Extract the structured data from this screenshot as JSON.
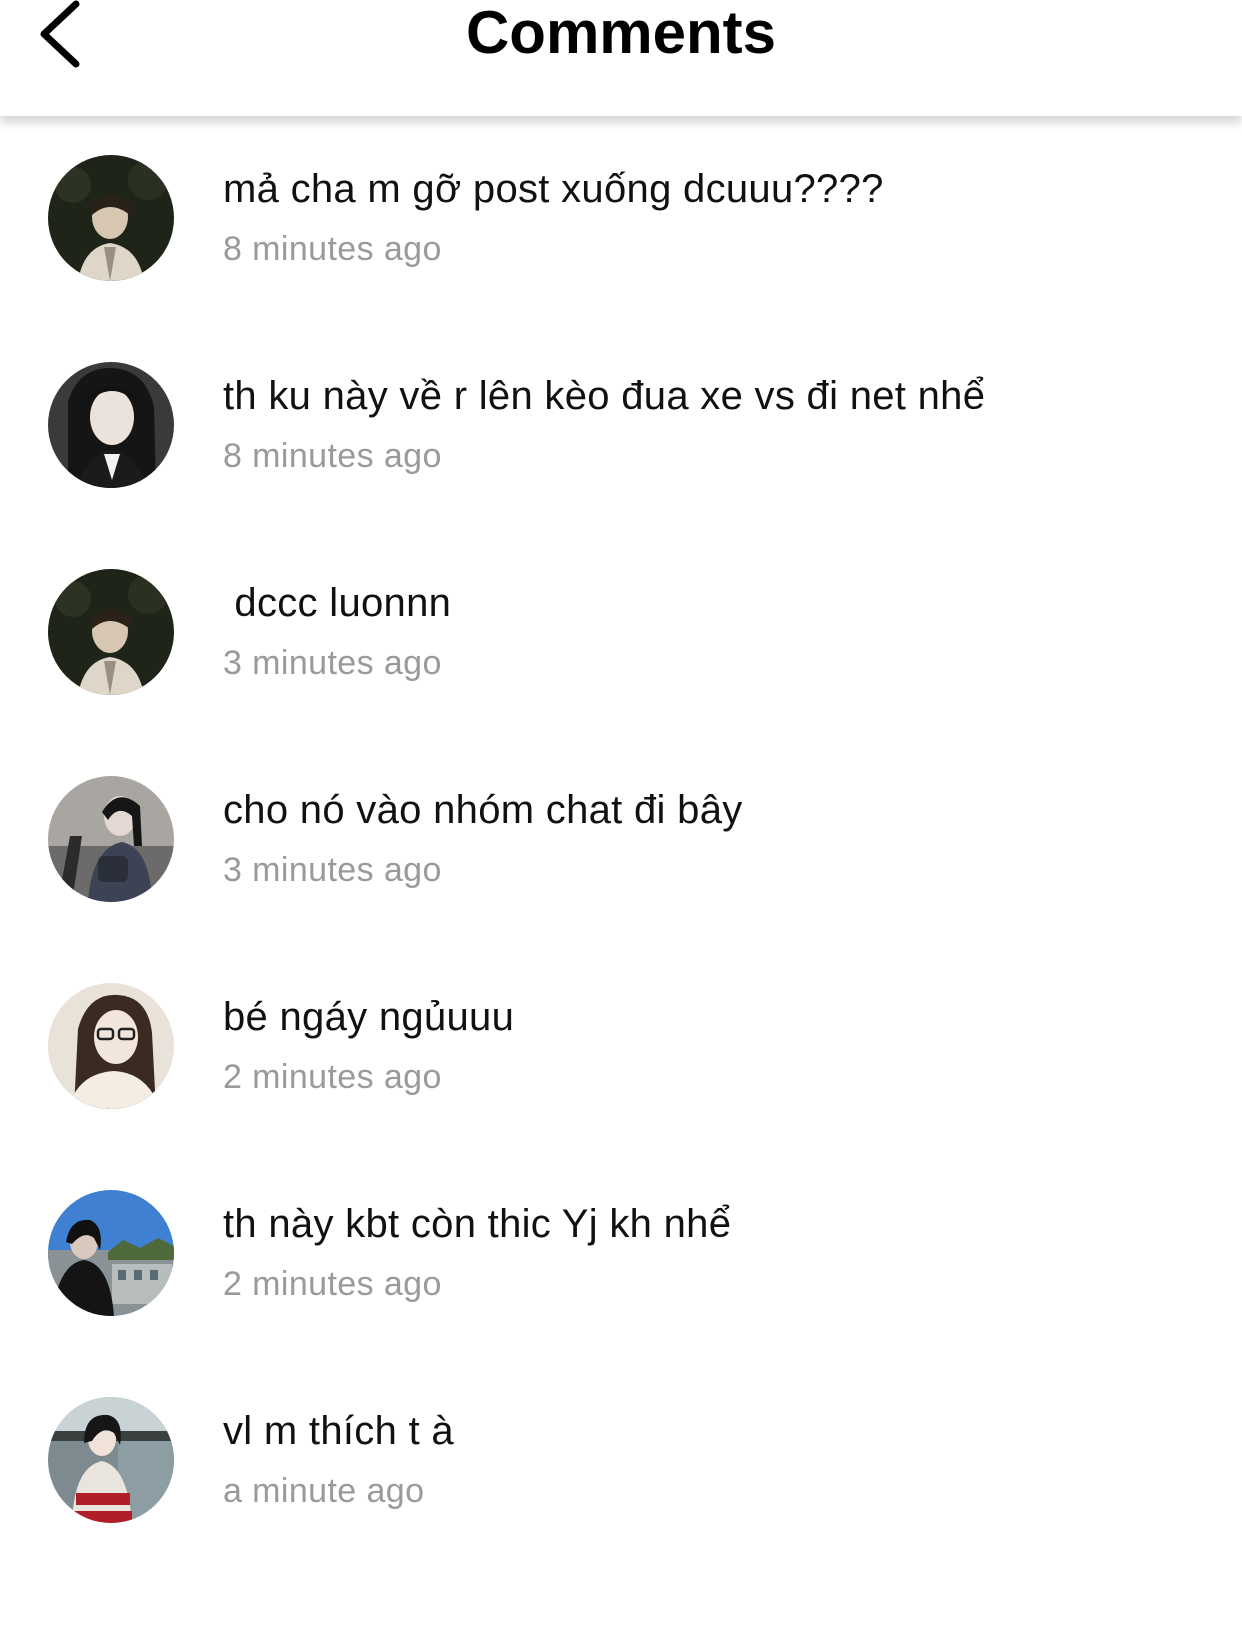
{
  "header": {
    "title": "Comments",
    "back_icon": "chevron-left-icon"
  },
  "comments": [
    {
      "text": "mả cha m gỡ post xuống dcuuu????",
      "time": "8 minutes ago",
      "avatar_palette": [
        "#1f2418",
        "#3a3324",
        "#d8cfc0"
      ]
    },
    {
      "text": "th ku này về r lên kèo đua xe vs đi net nhể",
      "time": "8 minutes ago",
      "avatar_palette": [
        "#2a2a2a",
        "#e8ddd6",
        "#111111"
      ]
    },
    {
      "text": " dccc luonnn",
      "time": "3 minutes ago",
      "avatar_palette": [
        "#1f2418",
        "#3a3324",
        "#d8cfc0"
      ]
    },
    {
      "text": "cho nó vào nhóm chat đi bây",
      "time": "3 minutes ago",
      "avatar_palette": [
        "#a7a39f",
        "#3d4250",
        "#1c1c1c"
      ]
    },
    {
      "text": "bé ngáy ngủuuu",
      "time": "2 minutes ago",
      "avatar_palette": [
        "#e5dfd6",
        "#3b2a22",
        "#f2ece2"
      ]
    },
    {
      "text": "th này kbt còn thic Yj kh nhể",
      "time": "2 minutes ago",
      "avatar_palette": [
        "#3f7fd1",
        "#1a1a1a",
        "#9aa4a8"
      ]
    },
    {
      "text": "vl m thích t à",
      "time": "a minute ago",
      "avatar_palette": [
        "#7c8a90",
        "#b01e2a",
        "#e9e4dc"
      ]
    }
  ]
}
